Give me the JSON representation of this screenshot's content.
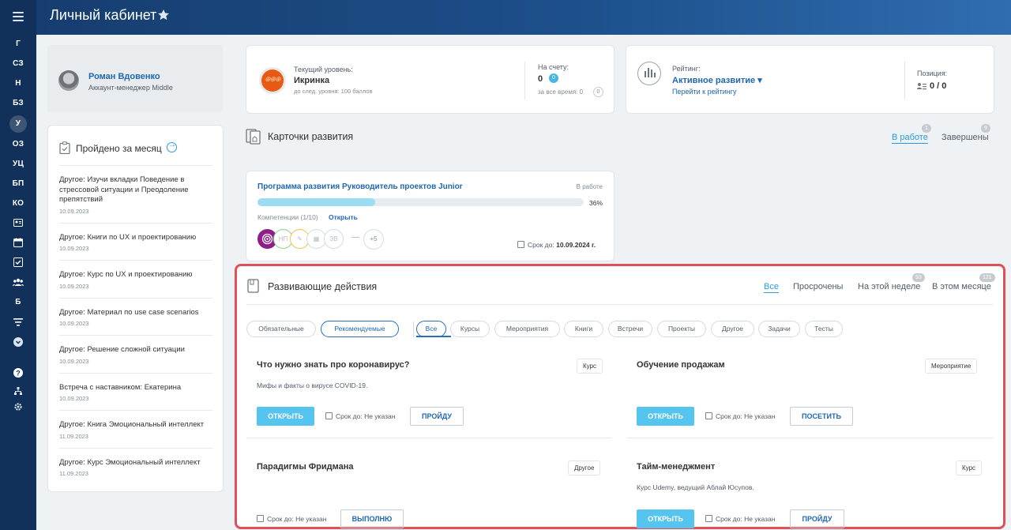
{
  "page_title": "Личный кабинет",
  "rail": {
    "items": [
      "Г",
      "СЗ",
      "Н",
      "БЗ",
      "У",
      "ОЗ",
      "УЦ",
      "БП",
      "КО"
    ],
    "active_index": 4,
    "icons": [
      "contact-card-icon",
      "calendar-icon",
      "checkbox-icon",
      "users-icon",
      "Б",
      "filter-icon",
      "chevron-circle-icon",
      "help-icon",
      "sitemap-icon",
      "gear-icon"
    ]
  },
  "user": {
    "name": "Роман Вдовенко",
    "role": "Аккаунт-менеджер Middle"
  },
  "month": {
    "title": "Пройдено за месяц",
    "items": [
      {
        "text": "Другое: Изучи вкладки Поведение в стрессовой ситуации и Преодоление препятствий",
        "date": "10.09.2023"
      },
      {
        "text": "Другое: Книги по UX и проектированию",
        "date": "10.09.2023"
      },
      {
        "text": "Другое: Курс по UX и проектированию",
        "date": "10.09.2023"
      },
      {
        "text": "Другое: Материал по use case scenarios",
        "date": "10.09.2023"
      },
      {
        "text": "Другое: Решение сложной ситуации",
        "date": "10.09.2023"
      },
      {
        "text": "Встреча с наставником: Екатерина",
        "date": "10.09.2023"
      },
      {
        "text": "Другое: Книга Эмоциональный интеллект",
        "date": "11.09.2023"
      },
      {
        "text": "Другое: Курс Эмоциональный интеллект",
        "date": "11.09.2023"
      }
    ]
  },
  "level": {
    "caption": "Текущий уровень:",
    "name": "Икринка",
    "next": "до след. уровня: 100 баллов",
    "account_caption": "На счету:",
    "account_value": "0",
    "account_badge": "0",
    "all_time": "за все время: 0",
    "all_time_badge": "0"
  },
  "rating": {
    "caption": "Рейтинг:",
    "name": "Активное развитие",
    "link": "Перейти к рейтингу",
    "position_caption": "Позиция:",
    "position_value": "0 / 0"
  },
  "dev_cards": {
    "title": "Карточки развития",
    "tabs": [
      {
        "label": "В работе",
        "count": "1"
      },
      {
        "label": "Завершены",
        "count": "9"
      }
    ],
    "program": {
      "title": "Программа развития Руководитель проектов Junior",
      "status": "В работе",
      "progress": 0.36,
      "progress_label": "36%",
      "competencies": "Компетенции (1/10)",
      "open_link": "Открыть",
      "comp_labels": [
        "",
        "НП",
        "",
        "",
        "ЗВ"
      ],
      "more": "+5",
      "due_label": "Срок до:",
      "due_value": "10.09.2024 г."
    }
  },
  "actions": {
    "title": "Развивающие действия",
    "tabs": [
      {
        "label": "Все",
        "count": ""
      },
      {
        "label": "Просрочены",
        "count": ""
      },
      {
        "label": "На этой неделе",
        "count": "93"
      },
      {
        "label": "В этом месяце",
        "count": "121"
      }
    ],
    "mode_chips": [
      "Обязательные",
      "Рекомендуемые"
    ],
    "filter_chips": [
      "Все",
      "Курсы",
      "Мероприятия",
      "Книги",
      "Встречи",
      "Проекты",
      "Другое",
      "Задачи",
      "Тесты"
    ],
    "items": [
      {
        "title": "Что нужно знать про коронавирус?",
        "tag": "Курс",
        "desc": "Мифы и факты о вирусе COVID-19.",
        "open": "ОТКРЫТЬ",
        "due": "Срок до: Не указан",
        "cta": "ПРОЙДУ"
      },
      {
        "title": "Обучение продажам",
        "tag": "Мероприятие",
        "desc": "",
        "open": "ОТКРЫТЬ",
        "due": "Срок до: Не указан",
        "cta": "ПОСЕТИТЬ"
      },
      {
        "title": "Парадигмы Фридмана",
        "tag": "Другое",
        "desc": "",
        "open": "",
        "due": "Срок до: Не указан",
        "cta": "ВЫПОЛНЮ"
      },
      {
        "title": "Тайм-менеджмент",
        "tag": "Курс",
        "desc": "Курс Udemy, ведущий Аблай Юсупов.",
        "open": "ОТКРЫТЬ",
        "due": "Срок до: Не указан",
        "cta": "ПРОЙДУ"
      }
    ]
  },
  "colors": {
    "accent": "#2067b0",
    "button": "#55c5ef",
    "highlight": "#e0505a",
    "level_badge": "#e85a13"
  }
}
